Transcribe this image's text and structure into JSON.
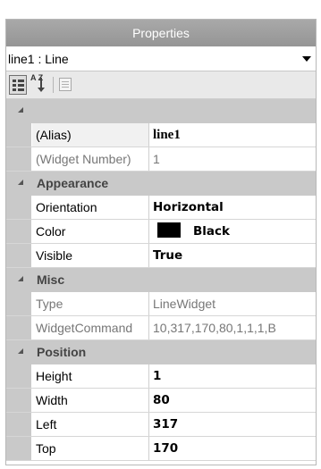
{
  "panel": {
    "title": "Properties",
    "object_selector": "line1 : Line"
  },
  "toolbar": {
    "categorized": "categorized-icon",
    "alphabetical": "sort-az-icon",
    "property_pages": "property-pages-icon",
    "sort_glyph": "A Z"
  },
  "grid": {
    "top_row": {
      "name": "(Alias)",
      "value": "line1"
    },
    "widget_number": {
      "name": "(Widget Number)",
      "value": "1"
    },
    "appearance": {
      "label": "Appearance",
      "orientation": {
        "name": "Orientation",
        "value": "Horizontal"
      },
      "color": {
        "name": "Color",
        "value": "Black",
        "swatch": "#000000"
      },
      "visible": {
        "name": "Visible",
        "value": "True"
      }
    },
    "misc": {
      "label": "Misc",
      "type": {
        "name": "Type",
        "value": "LineWidget"
      },
      "widget_command": {
        "name": "WidgetCommand",
        "value": "10,317,170,80,1,1,1,B"
      }
    },
    "position": {
      "label": "Position",
      "height": {
        "name": "Height",
        "value": "1"
      },
      "width": {
        "name": "Width",
        "value": "80"
      },
      "left": {
        "name": "Left",
        "value": "317"
      },
      "top": {
        "name": "Top",
        "value": "170"
      }
    }
  },
  "colors": {
    "title_bg": "#a0a0a0",
    "category_bg": "#c9c9c9",
    "dim_text": "#777777"
  }
}
